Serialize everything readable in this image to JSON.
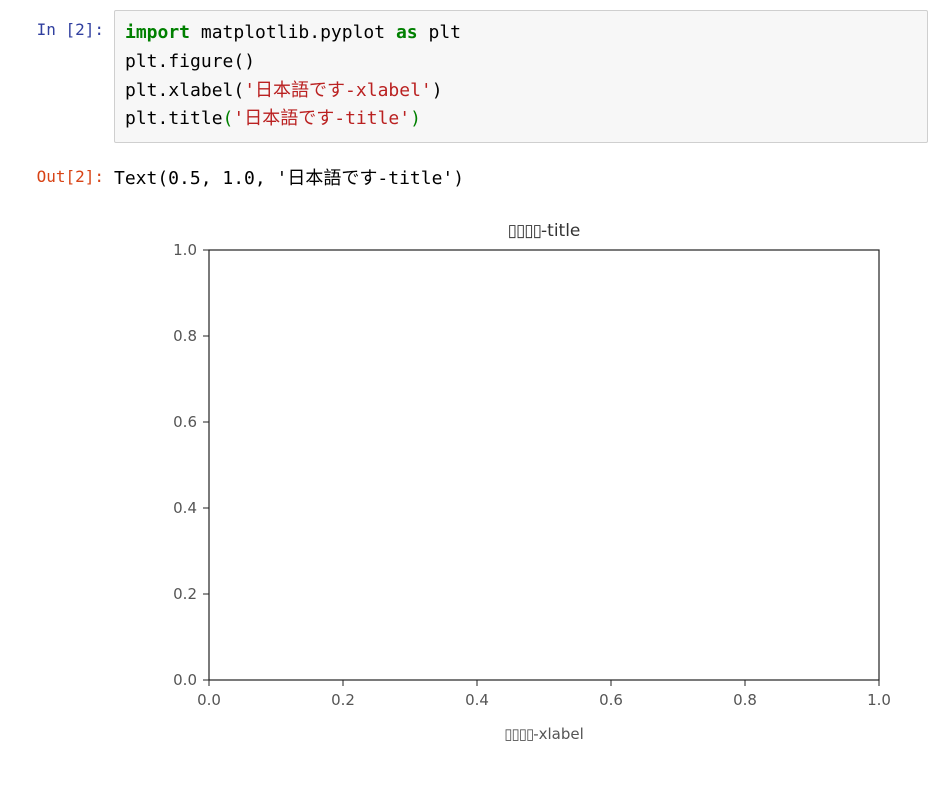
{
  "cell": {
    "in_prompt": "In [2]:",
    "out_prompt": "Out[2]:",
    "code": {
      "kw_import": "import",
      "module": "matplotlib.pyplot",
      "kw_as": "as",
      "alias": "plt",
      "figure_call": "plt.figure()",
      "xlabel_fn": "plt.xlabel(",
      "xlabel_arg": "'日本語です-xlabel'",
      "xlabel_close": ")",
      "title_fn": "plt.title",
      "title_open": "(",
      "title_arg": "'日本語です-title'",
      "title_close": ")"
    },
    "output_text": "Text(0.5, 1.0, '日本語です-title')"
  },
  "chart_data": {
    "type": "scatter",
    "series": [],
    "title": "▯▯▯▯-title",
    "xlabel": "▯▯▯▯-xlabel",
    "ylabel": "",
    "xlim": [
      0.0,
      1.0
    ],
    "ylim": [
      0.0,
      1.0
    ],
    "xticks": [
      "0.0",
      "0.2",
      "0.4",
      "0.6",
      "0.8",
      "1.0"
    ],
    "yticks": [
      "0.0",
      "0.2",
      "0.4",
      "0.6",
      "0.8",
      "1.0"
    ],
    "tofu_glyph": "▯",
    "title_suffix": "-title",
    "xlabel_suffix": "-xlabel"
  }
}
